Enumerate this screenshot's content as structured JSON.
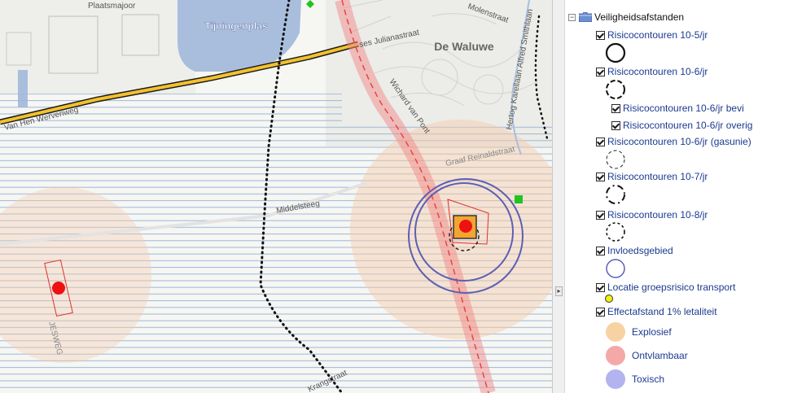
{
  "map": {
    "labels": {
      "lake": "Tijningenplas",
      "district": "De Waluwe",
      "plaatsmajoor": "Plaatsmajoor",
      "juliana": "ses Julianastraat",
      "molenstraat": "Molenstraat",
      "karel": "Hertog Karellaan Alfred Smithlaan",
      "wichard": "Wichard van Pont",
      "graaf": "Graaf Reinaldstraat",
      "middelsteeg": "Middelsteeg",
      "jesweg": "JESWEG",
      "krang": "Krangstraat",
      "road_left": "Van Hen Wervenweg"
    },
    "colors": {
      "stripe": "#9ab6d8",
      "highway": "#f2c12e",
      "effect_zone": "#f7c9a8",
      "influence": "#5b5fb5",
      "route": "#e84545"
    }
  },
  "splitter": {
    "arrow": "▸"
  },
  "legend": {
    "root": {
      "label": "Veiligheidsafstanden",
      "icon": "folder-icon",
      "expand_icon": "−"
    },
    "items": [
      {
        "label": "Risicocontouren 10-5/jr"
      },
      {
        "label": "Risicocontouren 10-6/jr"
      },
      {
        "label": "Risicocontouren 10-6/jr bevi"
      },
      {
        "label": "Risicocontouren 10-6/jr overig"
      },
      {
        "label": "Risicocontouren 10-6/jr (gasunie)"
      },
      {
        "label": "Risicocontouren 10-7/jr"
      },
      {
        "label": "Risicocontouren 10-8/jr"
      },
      {
        "label": "Invloedsgebied"
      },
      {
        "label": "Locatie groepsrisico transport"
      },
      {
        "label": "Effectafstand 1% letaliteit"
      }
    ],
    "swatches": [
      {
        "label": "Explosief",
        "color": "#f7d3a3"
      },
      {
        "label": "Ontvlambaar",
        "color": "#f4a8a8"
      },
      {
        "label": "Toxisch",
        "color": "#b3b3f0"
      }
    ]
  }
}
